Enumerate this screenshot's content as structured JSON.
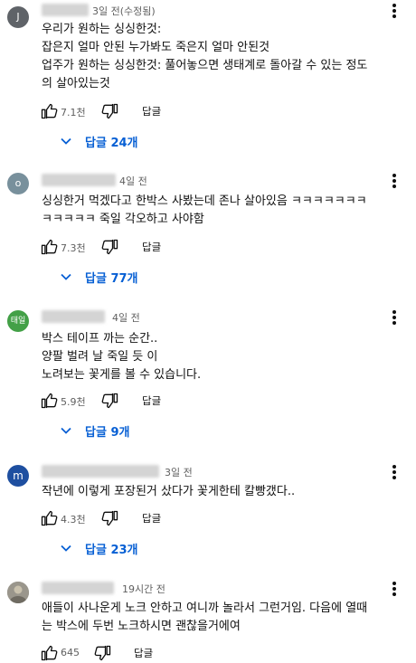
{
  "comments": [
    {
      "avatar_letter": "J",
      "avatar_color": "#5f6368",
      "time": "3일 전(수정됨)",
      "lines": [
        "우리가 원하는 싱싱한것:",
        "잡은지 얼마 안된 누가봐도 죽은지 얼마 안된것",
        "업주가 원하는 싱싱한것: 풀어놓으면 생태계로 돌아갈 수 있는 정도",
        "의 살아있는것"
      ],
      "likes": "7.1천",
      "reply_label": "답글",
      "replies_label": "답글 24개"
    },
    {
      "avatar_letter": "o",
      "avatar_color": "#78909c",
      "time": "4일 전",
      "lines": [
        "싱싱한거 먹겠다고 한박스 사봤는데 존나 살아있음 ㅋㅋㅋㅋㅋㅋㅋ",
        "ㅋㅋㅋㅋㅋ 죽일 각오하고 사야함"
      ],
      "likes": "7.3천",
      "reply_label": "답글",
      "replies_label": "답글 77개"
    },
    {
      "avatar_letter": "태일",
      "avatar_color": "#43a047",
      "time": "4일 전",
      "lines": [
        "박스 테이프 까는 순간..",
        "양팔 벌려 날 죽일 듯 이",
        "노려보는 꽃게를 볼 수 있습니다."
      ],
      "likes": "5.9천",
      "reply_label": "답글",
      "replies_label": "답글 9개"
    },
    {
      "avatar_letter": "m",
      "avatar_color": "#1e4fa0",
      "time": "3일 전",
      "lines": [
        "작년에 이렇게 포장된거 샀다가 꽃게한테 칼빵갰다.."
      ],
      "likes": "4.3천",
      "reply_label": "답글",
      "replies_label": "답글 23개"
    },
    {
      "avatar_letter": "",
      "avatar_color": "#8d8d86",
      "time": "19시간 전",
      "lines": [
        "애들이 사나운게 노크 안하고 여니까 놀라서 그런거임. 다음에 열때",
        "는 박스에 두번 노크하시면 괜찮을거에여"
      ],
      "likes": "645",
      "reply_label": "답글",
      "replies_label": ""
    }
  ]
}
